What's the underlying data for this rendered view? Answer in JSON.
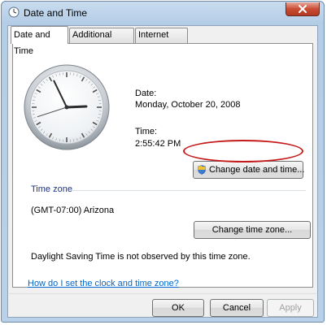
{
  "window": {
    "title": "Date and Time"
  },
  "tabs": [
    {
      "label": "Date and Time",
      "active": true
    },
    {
      "label": "Additional Clocks",
      "active": false
    },
    {
      "label": "Internet Time",
      "active": false
    }
  ],
  "clock": {
    "hour": 2,
    "minute": 55,
    "second": 42
  },
  "date_section": {
    "label": "Date:",
    "value": "Monday, October 20, 2008"
  },
  "time_section": {
    "label": "Time:",
    "value": "2:55:42 PM"
  },
  "change_datetime_button": {
    "label": "Change date and time..."
  },
  "timezone": {
    "heading": "Time zone",
    "value": "(GMT-07:00) Arizona",
    "change_button": "Change time zone...",
    "dst_note": "Daylight Saving Time is not observed by this time zone."
  },
  "help_link": "How do I set the clock and time zone?",
  "dialog_buttons": {
    "ok": "OK",
    "cancel": "Cancel",
    "apply": "Apply"
  },
  "colors": {
    "highlight_oval": "#c41a1a",
    "link": "#0066cc",
    "title_bar": "#b9d1e8"
  }
}
